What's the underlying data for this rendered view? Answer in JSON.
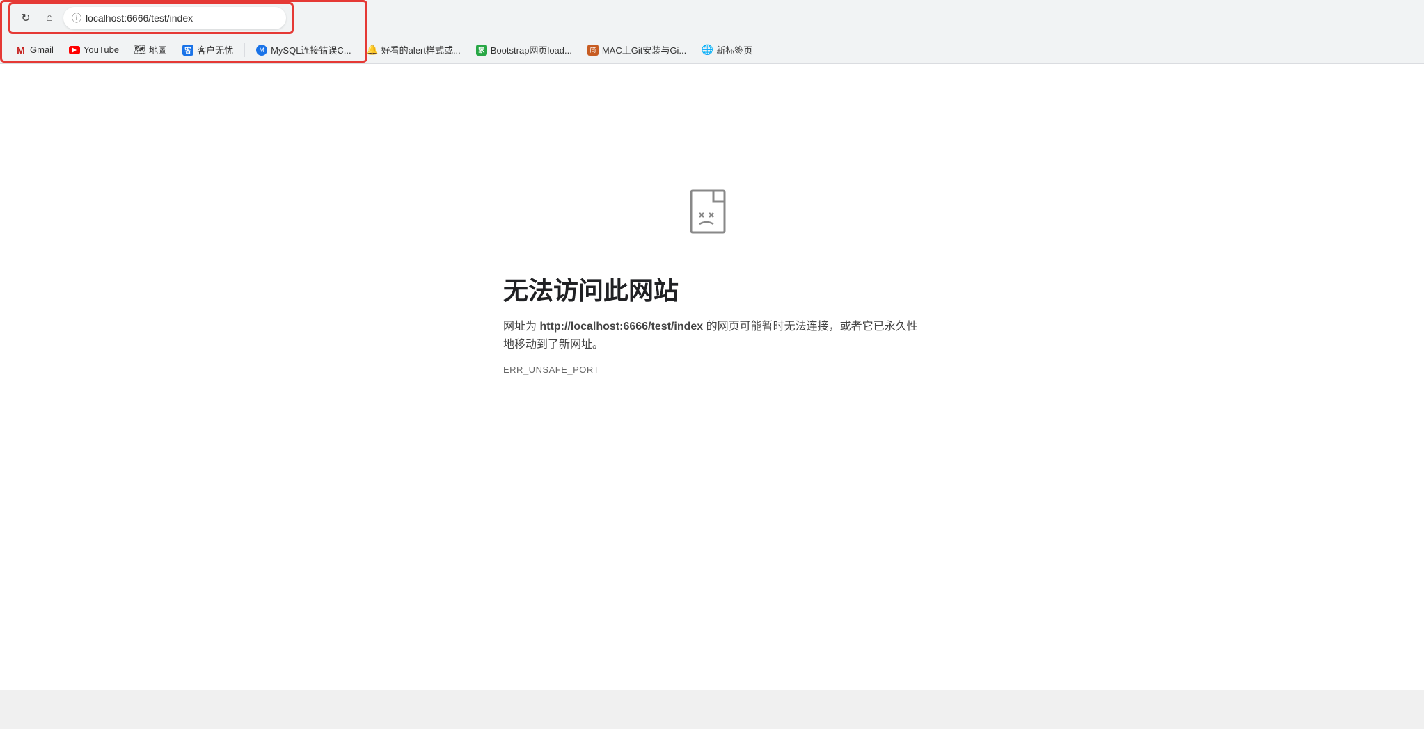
{
  "browser": {
    "address_bar": {
      "url": "localhost:6666/test/index",
      "info_icon": "ⓘ"
    },
    "nav_buttons": {
      "reload": "↻",
      "home": "⌂"
    },
    "bookmarks": [
      {
        "id": "gmail",
        "label": "Gmail",
        "icon_type": "gmail"
      },
      {
        "id": "youtube",
        "label": "YouTube",
        "icon_type": "youtube"
      },
      {
        "id": "maps",
        "label": "地圖",
        "icon_type": "maps"
      },
      {
        "id": "customer",
        "label": "客户无忧",
        "icon_type": "customer"
      },
      {
        "id": "mysql",
        "label": "MySQL连接错误C...",
        "icon_type": "mysql"
      },
      {
        "id": "alert",
        "label": "好看的alert样式或...",
        "icon_type": "alert"
      },
      {
        "id": "bootstrap",
        "label": "Bootstrap网页load...",
        "icon_type": "bootstrap"
      },
      {
        "id": "git",
        "label": "MAC上Git安装与Gi...",
        "icon_type": "git"
      },
      {
        "id": "newtab",
        "label": "新标签页",
        "icon_type": "newtab"
      }
    ]
  },
  "error_page": {
    "title": "无法访问此网站",
    "description_prefix": "网址为 ",
    "description_url": "http://localhost:6666/test/index",
    "description_suffix": " 的网页可能暂时无法连接，或者它已永久性地移动到了新网址。",
    "error_code": "ERR_UNSAFE_PORT"
  },
  "colors": {
    "highlight_border": "#e53935",
    "address_bar_bg": "#ffffff",
    "toolbar_bg": "#f1f3f4",
    "error_title_color": "#202124",
    "error_desc_color": "#444444",
    "error_code_color": "#666666",
    "url_color": "#1a0dab"
  }
}
